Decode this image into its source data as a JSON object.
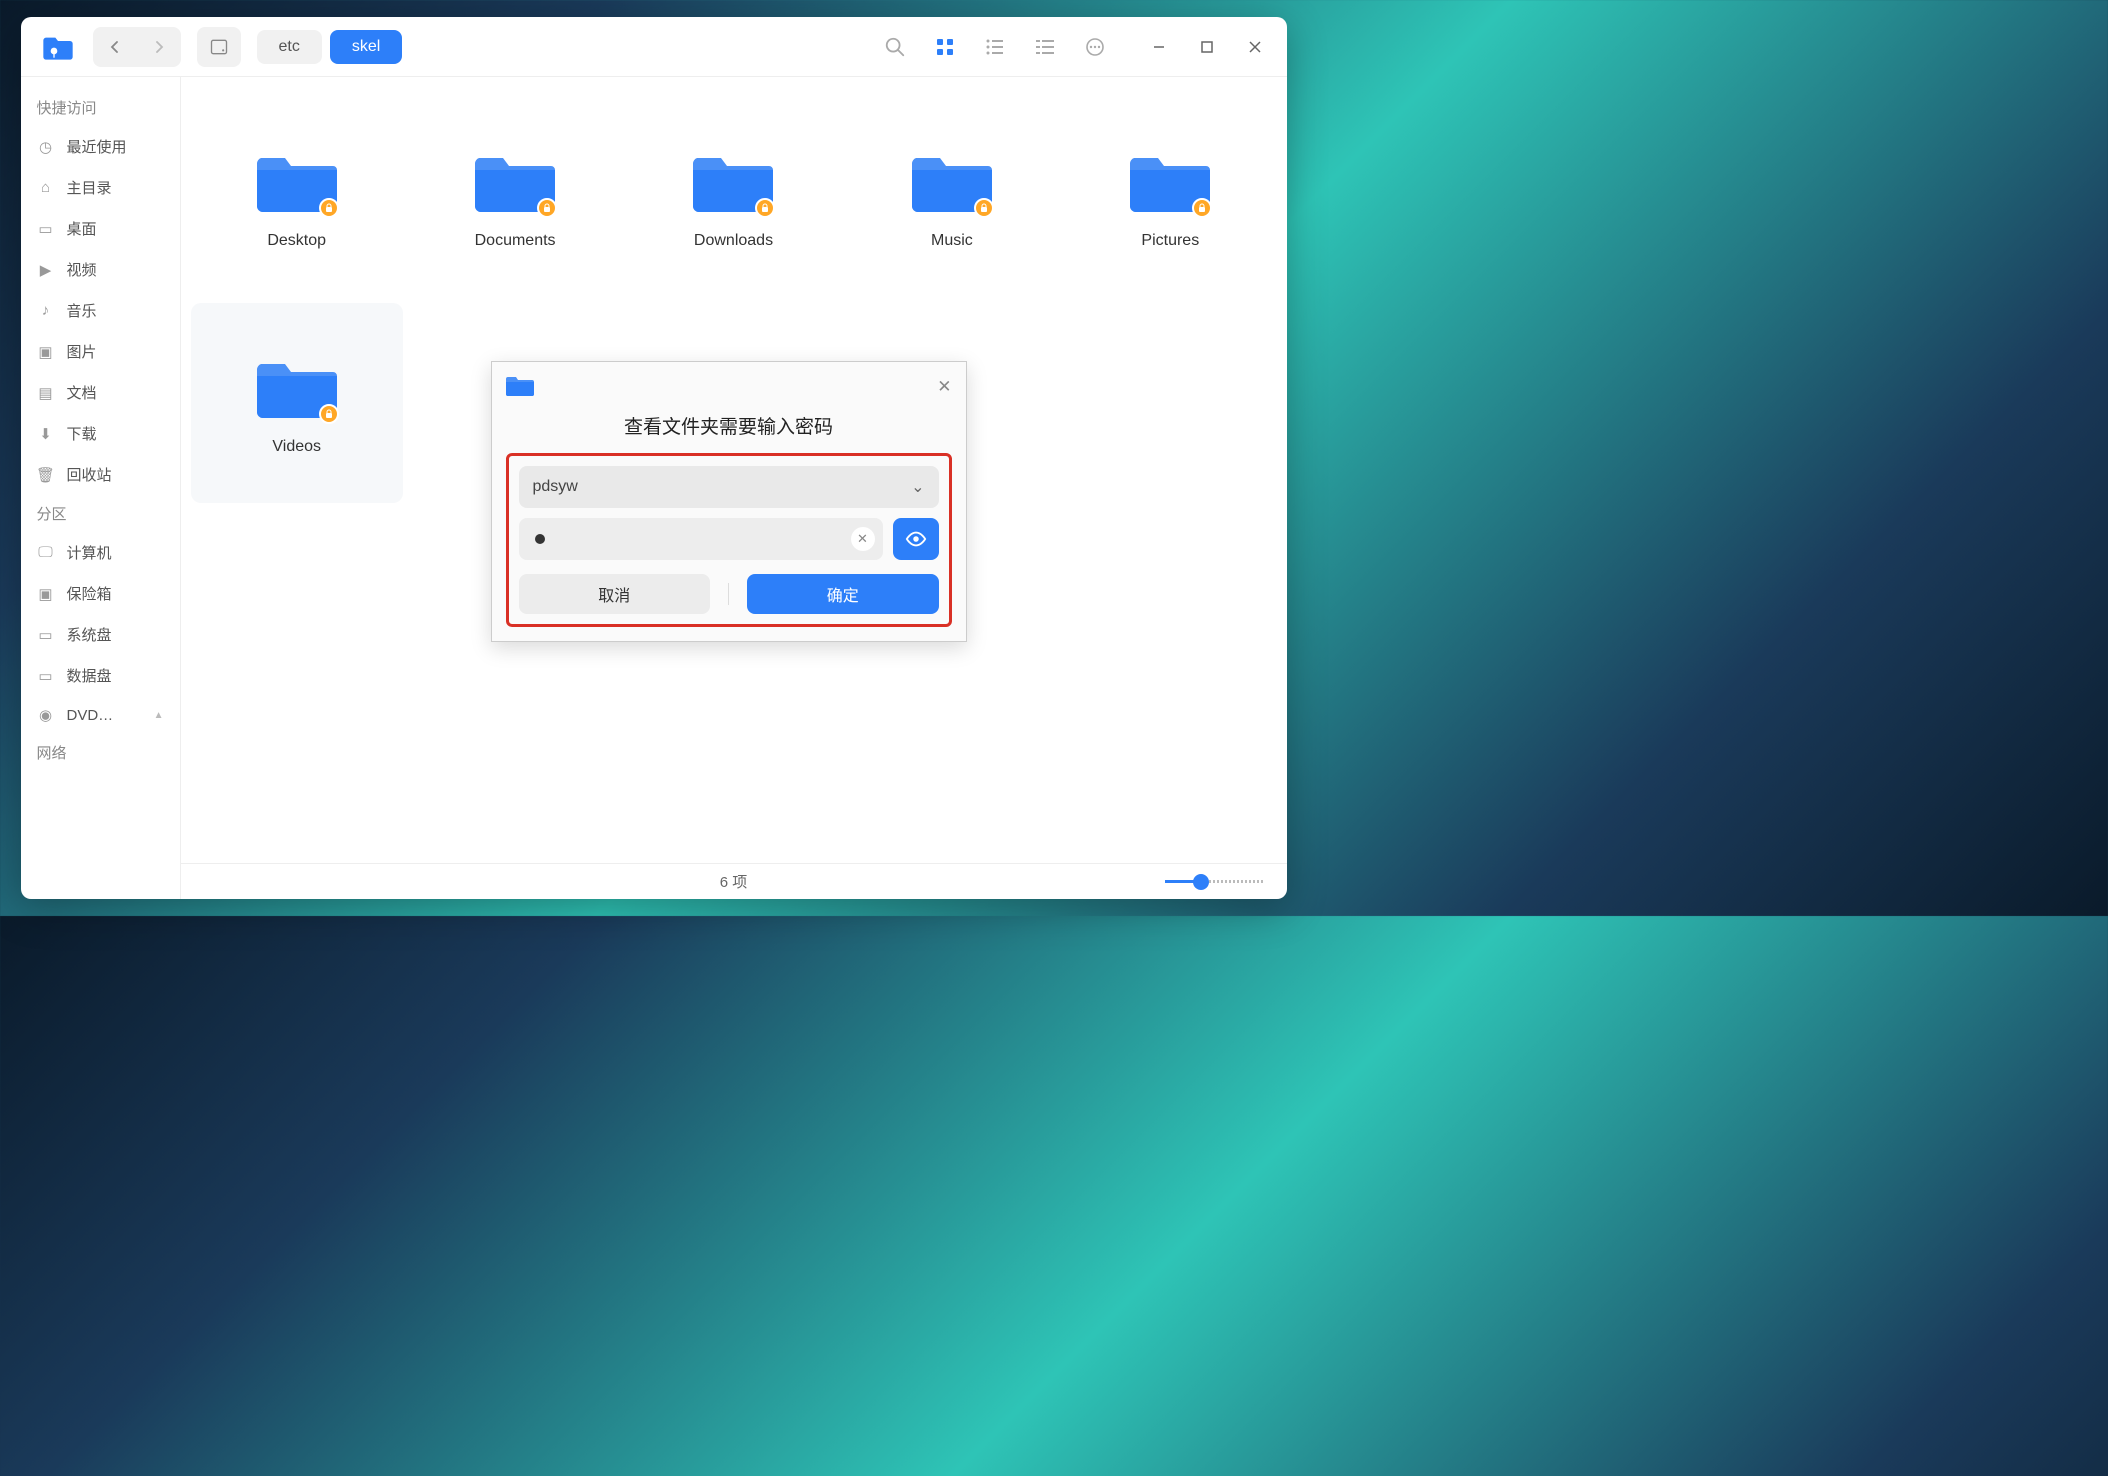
{
  "breadcrumb": {
    "items": [
      {
        "label": "etc"
      },
      {
        "label": "skel"
      }
    ],
    "activeIndex": 1
  },
  "sidebar": {
    "section_quick": "快捷访问",
    "items_quick": [
      {
        "label": "最近使用",
        "icon": "clock"
      },
      {
        "label": "主目录",
        "icon": "home"
      },
      {
        "label": "桌面",
        "icon": "desktop"
      },
      {
        "label": "视频",
        "icon": "video"
      },
      {
        "label": "音乐",
        "icon": "music"
      },
      {
        "label": "图片",
        "icon": "picture"
      },
      {
        "label": "文档",
        "icon": "document"
      },
      {
        "label": "下载",
        "icon": "download"
      },
      {
        "label": "回收站",
        "icon": "trash"
      }
    ],
    "section_partition": "分区",
    "items_partition": [
      {
        "label": "计算机",
        "icon": "computer"
      },
      {
        "label": "保险箱",
        "icon": "vault"
      },
      {
        "label": "系统盘",
        "icon": "disk"
      },
      {
        "label": "数据盘",
        "icon": "disk"
      },
      {
        "label": "DVD…",
        "icon": "disc",
        "eject": true
      }
    ],
    "section_network": "网络"
  },
  "files": [
    {
      "label": "Desktop",
      "locked": true
    },
    {
      "label": "Documents",
      "locked": true
    },
    {
      "label": "Downloads",
      "locked": true
    },
    {
      "label": "Music",
      "locked": true
    },
    {
      "label": "Pictures",
      "locked": true
    },
    {
      "label": "Videos",
      "locked": true
    }
  ],
  "status": {
    "text": "6 项"
  },
  "dialog": {
    "title": "查看文件夹需要输入密码",
    "user_value": "pdsyw",
    "password_masked": "•",
    "cancel": "取消",
    "ok": "确定"
  },
  "colors": {
    "accent": "#2d7ff9",
    "highlight": "#d93025"
  }
}
